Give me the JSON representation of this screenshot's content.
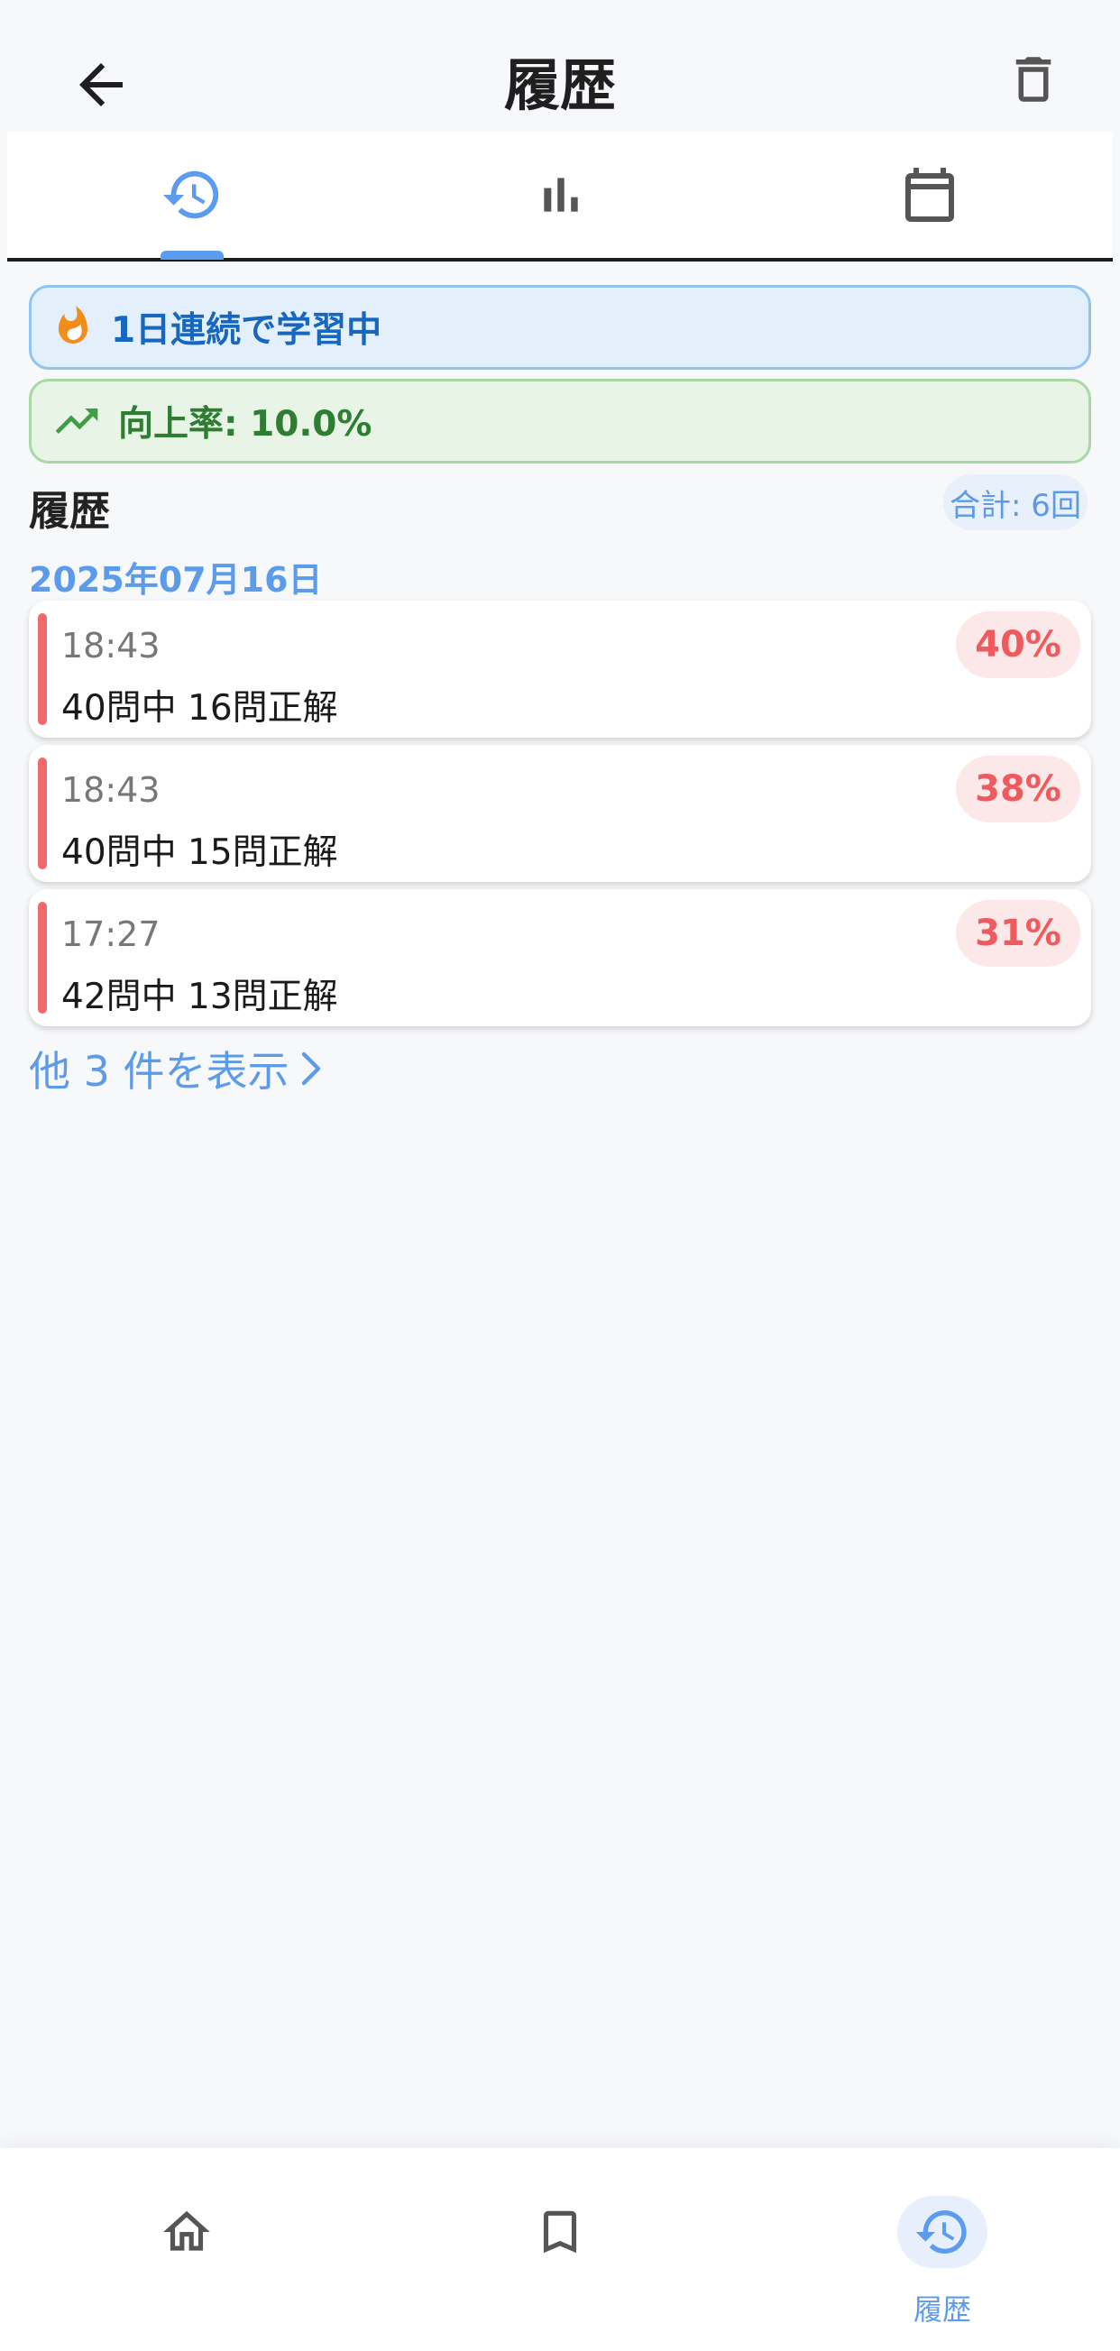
{
  "header": {
    "title": "履歴",
    "back_icon": "arrow-back-icon",
    "delete_icon": "trash-icon"
  },
  "tabs": [
    {
      "icon": "history-icon",
      "active": true
    },
    {
      "icon": "bar-chart-icon",
      "active": false
    },
    {
      "icon": "calendar-icon",
      "active": false
    }
  ],
  "banners": {
    "streak": {
      "icon": "fire-icon",
      "text": "1日連続で学習中"
    },
    "improvement": {
      "icon": "trending-up-icon",
      "text": "向上率: 10.0%"
    }
  },
  "history": {
    "title": "履歴",
    "total": "合計: 6回",
    "date": "2025年07月16日",
    "records": [
      {
        "time": "18:43",
        "result": "40問中 16問正解",
        "percent": "40%"
      },
      {
        "time": "18:43",
        "result": "40問中 15問正解",
        "percent": "38%"
      },
      {
        "time": "17:27",
        "result": "42問中 13問正解",
        "percent": "31%"
      }
    ],
    "show_more": "他 3 件を表示"
  },
  "bottom_nav": [
    {
      "icon": "home-icon",
      "label": ""
    },
    {
      "icon": "bookmark-icon",
      "label": ""
    },
    {
      "icon": "history-icon",
      "label": "履歴",
      "active": true
    }
  ],
  "colors": {
    "accent": "#5c9cef",
    "streak_text": "#1767bf",
    "improve_text": "#2e7d32",
    "error_bar": "#f06a6d",
    "badge_text": "#ef5a5e"
  }
}
